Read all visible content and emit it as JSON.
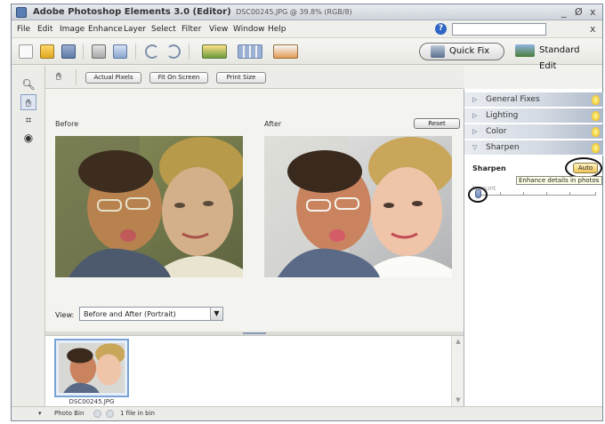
{
  "window": {
    "title": "Adobe Photoshop Elements 3.0 (Editor)",
    "document_info": "DSC00245.JPG @ 39.8% (RGB/8)",
    "minimize_glyph": "_",
    "maximize_glyph": "Ø",
    "close_glyph": "x",
    "doc_close_glyph": "x"
  },
  "menubar": {
    "items": [
      "File",
      "Edit",
      "Image",
      "Enhance",
      "Layer",
      "Select",
      "Filter",
      "View",
      "Window",
      "Help"
    ],
    "help_search_placeholder": "",
    "help_icon_glyph": "?"
  },
  "shortcuts": {
    "icons": [
      "new-icon",
      "open-icon",
      "save-icon",
      "print-icon",
      "online-print-icon",
      "undo-icon",
      "redo-icon",
      "create-icon",
      "organizer-icon",
      "photomail-icon"
    ],
    "quick_fix_label": "Quick Fix",
    "standard_edit_label": "Standard Edit",
    "active_mode": "Quick Fix"
  },
  "toolbox": {
    "tools": [
      "zoom-tool",
      "hand-tool",
      "crop-tool",
      "red-eye-tool"
    ],
    "active_tool": "hand-tool"
  },
  "options_bar": {
    "actual_pixels": "Actual Pixels",
    "fit_on_screen": "Fit On Screen",
    "print_size": "Print Size"
  },
  "workspace": {
    "before_label": "Before",
    "after_label": "After",
    "reset_label": "Reset",
    "view_label": "View:",
    "view_value": "Before and After (Portrait)"
  },
  "photo_bin": {
    "thumbnail_name": "DSC00245.JPG",
    "status_label": "Photo Bin",
    "file_count_text": "1 file in bin"
  },
  "palette": {
    "sections": [
      {
        "label": "General Fixes",
        "expanded": false
      },
      {
        "label": "Lighting",
        "expanded": false
      },
      {
        "label": "Color",
        "expanded": false
      },
      {
        "label": "Sharpen",
        "expanded": true
      }
    ],
    "sharpen_label": "Sharpen",
    "auto_label": "Auto",
    "tooltip": "Enhance details in photos",
    "amount_label": "Amount",
    "amount_value": 0
  },
  "colors": {
    "accent": "#2f65c4",
    "palette_header": "#d4dae3",
    "auto_button": "#f0c75a",
    "slider_thumb": "#6f88b8"
  }
}
